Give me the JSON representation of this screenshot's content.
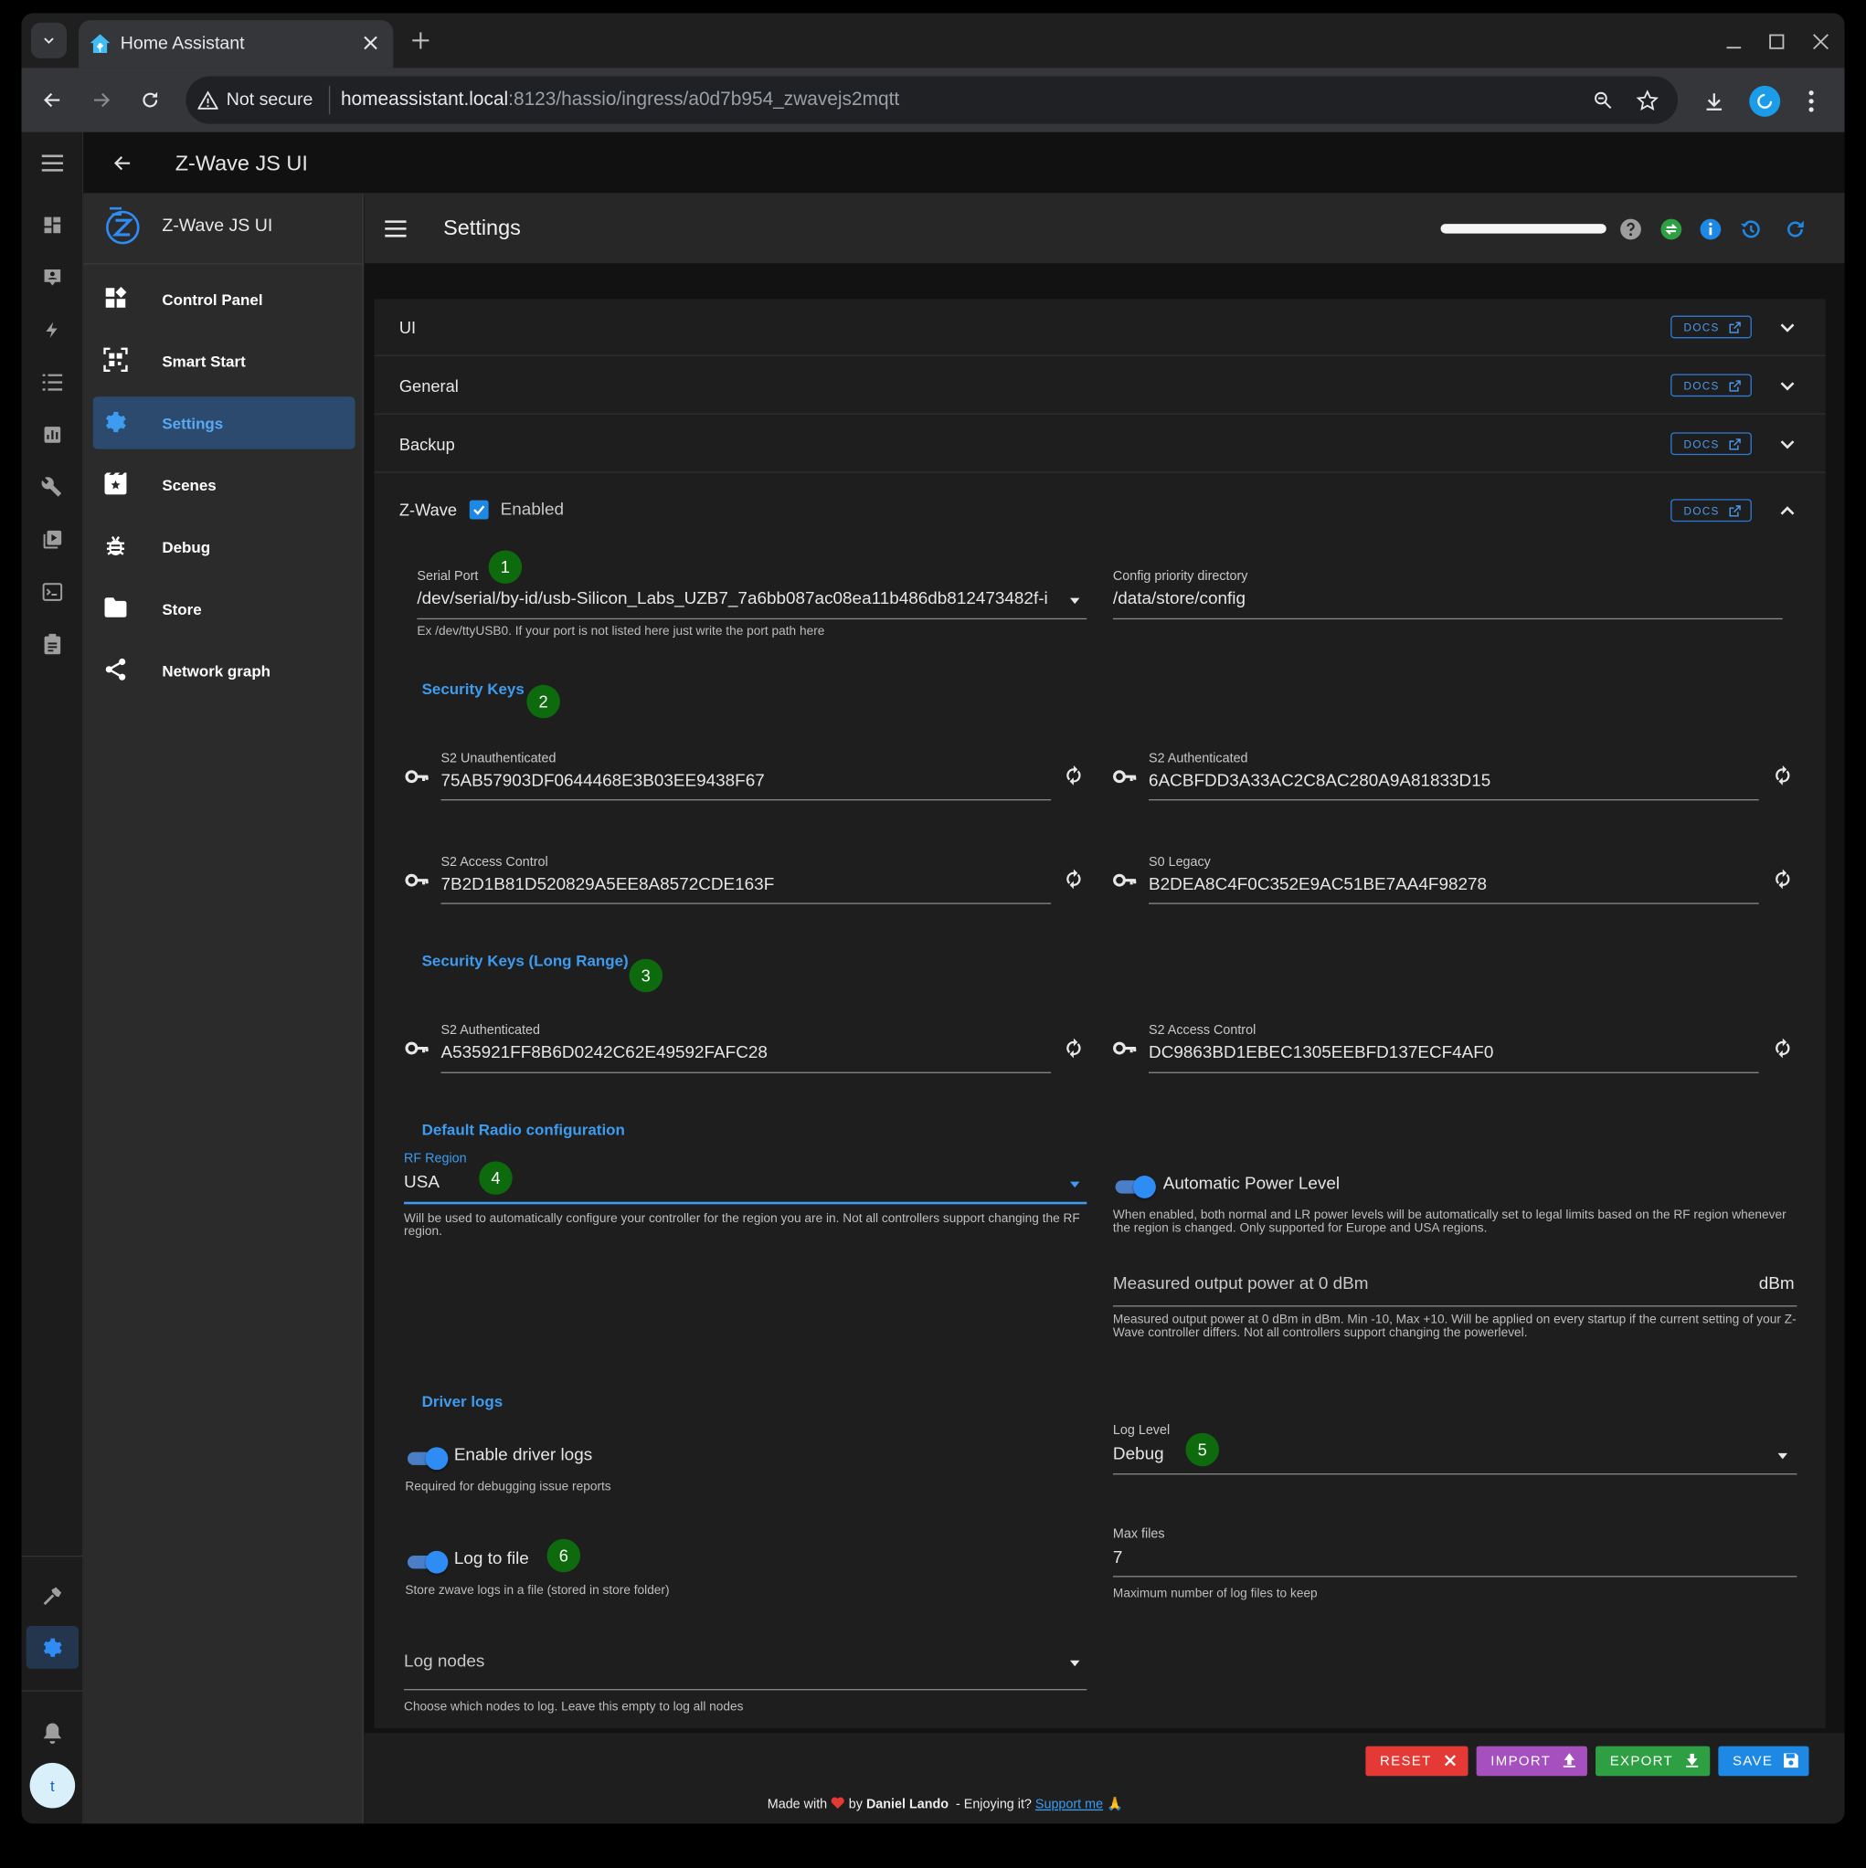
{
  "browser": {
    "tab_title": "Home Assistant",
    "security_label": "Not secure",
    "url_host": "homeassistant.local",
    "url_rest": ":8123/hassio/ingress/a0d7b954_zwavejs2mqtt"
  },
  "ha": {
    "topbar_title": "Z-Wave JS UI",
    "user_initial": "t"
  },
  "zw_sidebar": {
    "title": "Z-Wave JS UI",
    "items": [
      {
        "label": "Control Panel"
      },
      {
        "label": "Smart Start"
      },
      {
        "label": "Settings"
      },
      {
        "label": "Scenes"
      },
      {
        "label": "Debug"
      },
      {
        "label": "Store"
      },
      {
        "label": "Network graph"
      }
    ]
  },
  "appbar": {
    "title": "Settings"
  },
  "sections": {
    "ui": "UI",
    "general": "General",
    "backup": "Backup",
    "zwave": "Z-Wave",
    "zwave_enabled": "Enabled",
    "docs": "DOCS"
  },
  "zwave": {
    "serial_port": {
      "label": "Serial Port",
      "value": "/dev/serial/by-id/usb-Silicon_Labs_UZB7_7a6bb087ac08ea11b486db812473482f-i",
      "hint": "Ex /dev/ttyUSB0. If your port is not listed here just write the port path here"
    },
    "config_dir": {
      "label": "Config priority directory",
      "value": "/data/store/config"
    },
    "security_keys": {
      "heading": "Security Keys",
      "s2_unauth": {
        "label": "S2 Unauthenticated",
        "value": "75AB57903DF0644468E3B03EE9438F67"
      },
      "s2_auth": {
        "label": "S2 Authenticated",
        "value": "6ACBFDD3A33AC2C8AC280A9A81833D15"
      },
      "s2_access": {
        "label": "S2 Access Control",
        "value": "7B2D1B81D520829A5EE8A8572CDE163F"
      },
      "s0_legacy": {
        "label": "S0 Legacy",
        "value": "B2DEA8C4F0C352E9AC51BE7AA4F98278"
      }
    },
    "security_keys_lr": {
      "heading": "Security Keys (Long Range)",
      "s2_auth": {
        "label": "S2 Authenticated",
        "value": "A535921FF8B6D0242C62E49592FAFC28"
      },
      "s2_access": {
        "label": "S2 Access Control",
        "value": "DC9863BD1EBEC1305EEBFD137ECF4AF0"
      }
    },
    "radio": {
      "heading": "Default Radio configuration",
      "rf_region": {
        "label": "RF Region",
        "value": "USA",
        "hint": "Will be used to automatically configure your controller for the region you are in. Not all controllers support changing the RF region."
      },
      "auto_power": {
        "label": "Automatic Power Level",
        "hint": "When enabled, both normal and LR power levels will be automatically set to legal limits based on the RF region whenever the region is changed. Only supported for Europe and USA regions."
      },
      "measured_power": {
        "label": "Measured output power at 0 dBm",
        "unit": "dBm",
        "hint": "Measured output power at 0 dBm in dBm. Min -10, Max +10. Will be applied on every startup if the current setting of your Z-Wave controller differs. Not all controllers support changing the powerlevel."
      }
    },
    "driver_logs": {
      "heading": "Driver logs",
      "enable": {
        "label": "Enable driver logs",
        "hint": "Required for debugging issue reports"
      },
      "log_level": {
        "label": "Log Level",
        "value": "Debug"
      },
      "log_to_file": {
        "label": "Log to file",
        "hint": "Store zwave logs in a file (stored in store folder)"
      },
      "max_files": {
        "label": "Max files",
        "value": "7",
        "hint": "Maximum number of log files to keep"
      },
      "log_nodes": {
        "label": "Log nodes",
        "hint": "Choose which nodes to log. Leave this empty to log all nodes"
      }
    }
  },
  "badges": [
    "1",
    "2",
    "3",
    "4",
    "5",
    "6"
  ],
  "actions": {
    "reset": "RESET",
    "import": "IMPORT",
    "export": "EXPORT",
    "save": "SAVE"
  },
  "footer": {
    "made_with": "Made with",
    "by": "by",
    "author": "Daniel Lando",
    "enjoying": "- Enjoying it?",
    "support": "Support me",
    "pray": "🙏"
  },
  "colors": {
    "accent": "#3d9cf0",
    "reset": "#e53935",
    "import": "#a64fbf",
    "export": "#2ea043",
    "save": "#1e88e5",
    "badge": "#0d6b0d"
  }
}
